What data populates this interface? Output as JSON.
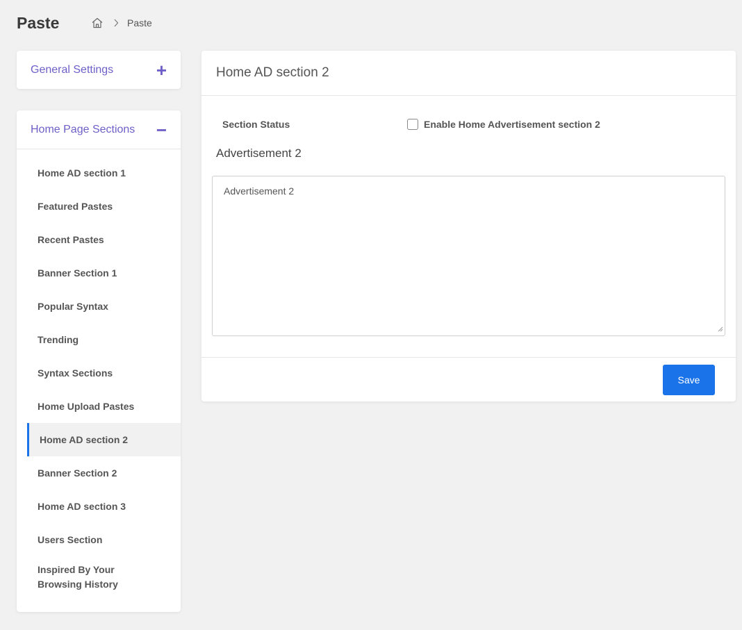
{
  "header": {
    "title": "Paste",
    "breadcrumb": {
      "home_icon": "home-icon",
      "separator_icon": "chevron-right-icon",
      "current": "Paste"
    }
  },
  "sidebar": {
    "general": {
      "label": "General Settings",
      "toggle": "+"
    },
    "sections": {
      "label": "Home Page Sections",
      "toggle": "−",
      "items": [
        {
          "label": "Home AD section 1"
        },
        {
          "label": "Featured Pastes"
        },
        {
          "label": "Recent Pastes"
        },
        {
          "label": "Banner Section 1"
        },
        {
          "label": "Popular Syntax"
        },
        {
          "label": "Trending"
        },
        {
          "label": "Syntax Sections"
        },
        {
          "label": "Home Upload Pastes"
        },
        {
          "label": "Home AD section 2",
          "active": true
        },
        {
          "label": "Banner Section 2"
        },
        {
          "label": "Home AD section 3"
        },
        {
          "label": "Users Section"
        },
        {
          "label": "Inspired By Your Browsing History"
        }
      ]
    }
  },
  "main": {
    "title": "Home AD section 2",
    "status_label": "Section Status",
    "checkbox_label": "Enable Home Advertisement section 2",
    "checkbox_checked": false,
    "field_label": "Advertisement 2",
    "textarea_value": "Advertisement 2",
    "save_label": "Save"
  },
  "colors": {
    "accent": "#6d5fc7",
    "primary_button": "#1a73e8",
    "active_indicator": "#1a73e8",
    "background": "#f1f1f1"
  }
}
